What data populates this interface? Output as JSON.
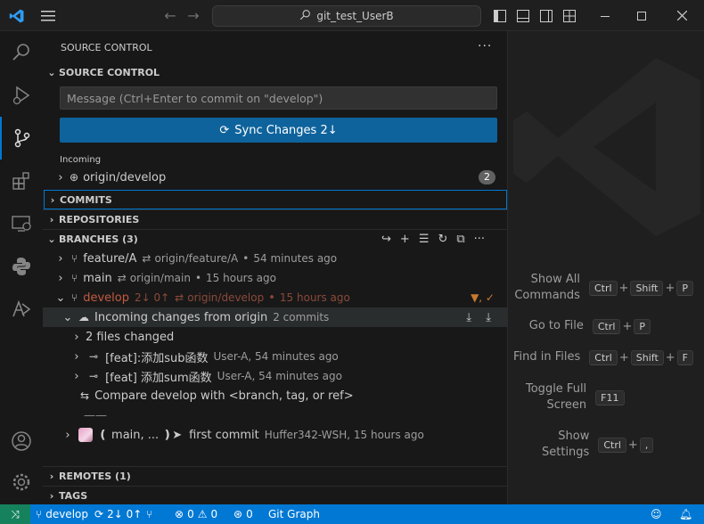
{
  "titlebar": {
    "search_text": "git_test_UserB"
  },
  "sidebar": {
    "view_title": "SOURCE CONTROL",
    "section_title": "SOURCE CONTROL",
    "message_placeholder": "Message (Ctrl+Enter to commit on \"develop\")",
    "sync_button": "Sync Changes 2↓",
    "incoming_label": "Incoming",
    "incoming_item": {
      "label": "origin/develop",
      "count": "2"
    },
    "commits_header": "COMMITS",
    "repositories_header": "REPOSITORIES",
    "branches_header": "BRANCHES (3)",
    "branches": [
      {
        "name": "feature/A",
        "upstream": "origin/feature/A",
        "time": "54 minutes ago"
      },
      {
        "name": "main",
        "upstream": "origin/main",
        "time": "15 hours ago"
      },
      {
        "name": "develop",
        "sync": "2↓ 0↑",
        "upstream": "origin/develop",
        "time": "15 hours ago",
        "status": "▼, ✓"
      }
    ],
    "incoming_changes": {
      "label": "Incoming changes from origin",
      "count": "2 commits"
    },
    "files_changed": "2 files changed",
    "incoming_commits": [
      {
        "message": "[feat]:添加sub函数",
        "author": "User-A, 54 minutes ago"
      },
      {
        "message": "[feat] 添加sum函数",
        "author": "User-A, 54 minutes ago"
      }
    ],
    "compare_label": "Compare develop with <branch, tag, or ref>",
    "separator": "——",
    "last_commit": {
      "refs": "❪ main, ... ❫➤",
      "message": "first commit",
      "author": "Huffer342-WSH, 15 hours ago"
    },
    "remotes_header": "REMOTES (1)",
    "tags_header": "TAGS"
  },
  "editor_hints": [
    {
      "label_lines": [
        "Show All",
        "Commands"
      ],
      "keys": [
        "Ctrl",
        "+",
        "Shift",
        "+",
        "P"
      ]
    },
    {
      "label_lines": [
        "Go to File"
      ],
      "keys": [
        "Ctrl",
        "+",
        "P"
      ]
    },
    {
      "label_lines": [
        "Find in Files"
      ],
      "keys": [
        "Ctrl",
        "+",
        "Shift",
        "+",
        "F"
      ]
    },
    {
      "label_lines": [
        "Toggle Full",
        "Screen"
      ],
      "keys": [
        "F11"
      ]
    },
    {
      "label_lines": [
        "Show",
        "Settings"
      ],
      "keys": [
        "Ctrl",
        "+",
        ","
      ]
    }
  ],
  "statusbar": {
    "branch": "develop",
    "sync": "2↓ 0↑",
    "errors": "0",
    "warnings": "0",
    "ports": "0",
    "git_graph": "Git Graph"
  },
  "colors": {
    "accent": "#0078d4",
    "sync_button": "#0e639c",
    "branch_develop": "#c25b3f",
    "focus_border": "#0078d4"
  }
}
